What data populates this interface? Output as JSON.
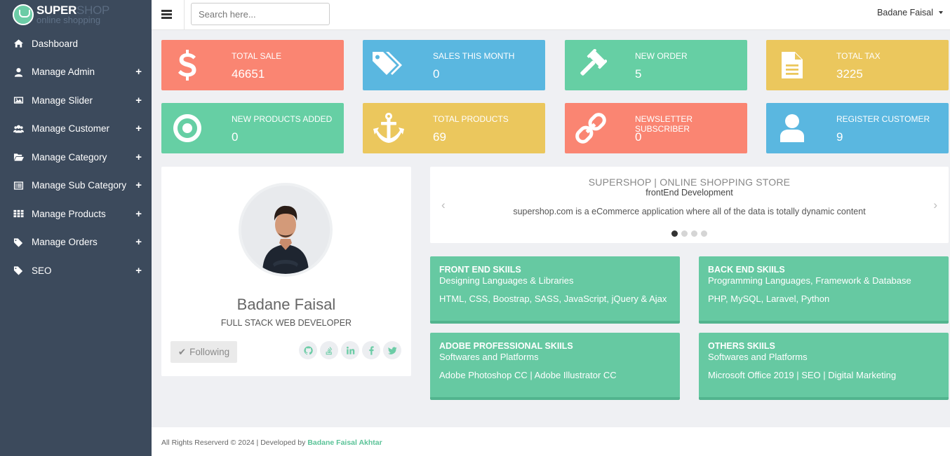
{
  "brand": {
    "name_bold": "SUPER",
    "name_light": "SHOP",
    "tagline": "online shopping"
  },
  "sidebar": {
    "items": [
      {
        "label": "Dashboard",
        "icon": "home-icon",
        "expandable": false
      },
      {
        "label": "Manage Admin",
        "icon": "user-icon",
        "expandable": true
      },
      {
        "label": "Manage Slider",
        "icon": "image-icon",
        "expandable": true
      },
      {
        "label": "Manage Customer",
        "icon": "users-icon",
        "expandable": true
      },
      {
        "label": "Manage Category",
        "icon": "folder-open-icon",
        "expandable": true
      },
      {
        "label": "Manage Sub Category",
        "icon": "list-alt-icon",
        "expandable": true
      },
      {
        "label": "Manage Products",
        "icon": "grid-icon",
        "expandable": true
      },
      {
        "label": "Manage Orders",
        "icon": "tags-icon",
        "expandable": true
      },
      {
        "label": "SEO",
        "icon": "tags-icon",
        "expandable": true
      }
    ],
    "expand_symbol": "+"
  },
  "header": {
    "search_placeholder": "Search here...",
    "user_name": "Badane Faisal"
  },
  "stats": [
    {
      "title": "TOTAL SALE",
      "value": "46651",
      "icon": "dollar-icon",
      "color": "#fa8572"
    },
    {
      "title": "SALES THIS MONTH",
      "value": "0",
      "icon": "tags-icon",
      "color": "#5ab7e0"
    },
    {
      "title": "NEW ORDER",
      "value": "5",
      "icon": "gavel-icon",
      "color": "#66cfa4"
    },
    {
      "title": "TOTAL TAX",
      "value": "3225",
      "icon": "file-icon",
      "color": "#ebc75d"
    },
    {
      "title": "NEW PRODUCTS ADDED",
      "value": "0",
      "icon": "bullseye-icon",
      "color": "#66cfa4"
    },
    {
      "title": "TOTAL PRODUCTS",
      "value": "69",
      "icon": "anchor-icon",
      "color": "#ebc75d"
    },
    {
      "title": "NEWSLETTER SUBSCRIBER",
      "value": "0",
      "icon": "chain-icon",
      "color": "#fa8572"
    },
    {
      "title": "REGISTER CUSTOMER",
      "value": "9",
      "icon": "user-icon",
      "color": "#5ab7e0"
    }
  ],
  "profile": {
    "name": "Badane Faisal",
    "role": "FULL STACK WEB DEVELOPER",
    "follow_label": "Following",
    "socials": [
      "github-icon",
      "stackoverflow-icon",
      "linkedin-icon",
      "facebook-icon",
      "twitter-icon"
    ]
  },
  "carousel": {
    "title": "SUPERSHOP | ONLINE SHOPPING STORE",
    "subtitle": "frontEnd Development",
    "description": "supershop.com is a eCommerce application where all of the data is totally dynamic content",
    "prev": "‹",
    "next": "›",
    "slides": 4,
    "active_slide": 1
  },
  "skills": [
    {
      "title": "FRONT END SKIILS",
      "subtitle": "Designing Languages & Libraries",
      "tags": "HTML, CSS, Boostrap, SASS, JavaScript, jQuery & Ajax"
    },
    {
      "title": "BACK END SKIILS",
      "subtitle": "Programming Languages, Framework & Database",
      "tags": "PHP, MySQL, Laravel, Python"
    },
    {
      "title": "ADOBE PROFESSIONAL SKIILS",
      "subtitle": "Softwares and Platforms",
      "tags": "Adobe Photoshop CC | Adobe Illustrator CC"
    },
    {
      "title": "OTHERS SKIILS",
      "subtitle": "Softwares and Platforms",
      "tags": "Microsoft Office 2019 | SEO | Digital Marketing"
    }
  ],
  "footer": {
    "text": "All Rights Reserverd © 2024 | Developed by",
    "developer": "Badane Faisal Akhtar"
  }
}
